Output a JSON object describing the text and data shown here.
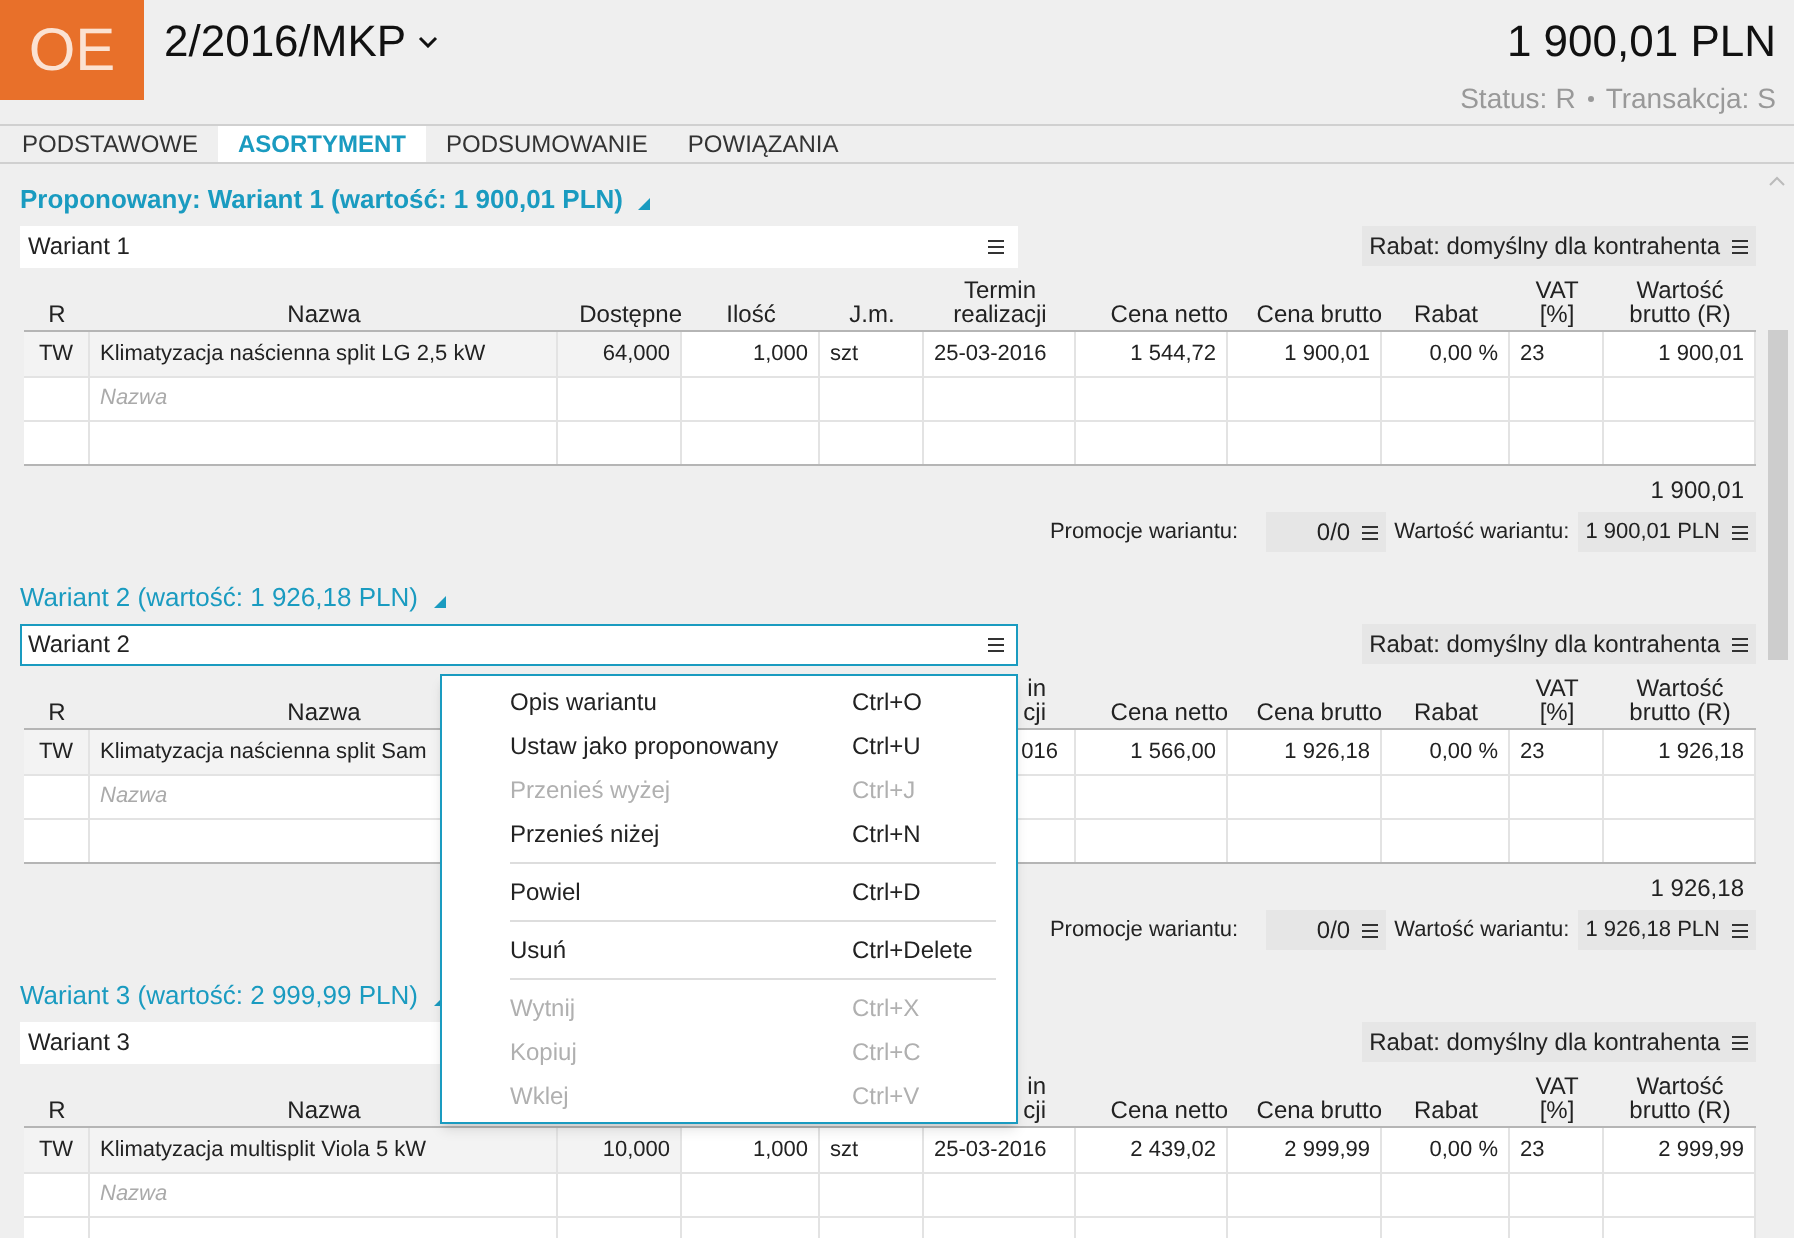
{
  "header": {
    "logo": "OE",
    "document": "2/2016/MKP",
    "amount": "1 900,01 PLN",
    "status_label": "Status:",
    "status": "R",
    "transaction_label": "Transakcja:",
    "transaction": "S"
  },
  "tabs": [
    {
      "label": "PODSTAWOWE",
      "selected": false
    },
    {
      "label": "ASORTYMENT",
      "selected": true
    },
    {
      "label": "PODSUMOWANIE",
      "selected": false
    },
    {
      "label": "POWIĄZANIA",
      "selected": false
    }
  ],
  "variants": [
    {
      "title": "Proponowany: Wariant 1 (wartość: 1 900,01 PLN)",
      "proposed": true,
      "name_field": "Wariant 1",
      "focused": false,
      "field_icon": true,
      "discount": "Rabat: domyślny dla kontrahenta",
      "columns": [
        "R",
        "Nazwa",
        "Dostępne",
        "Ilość",
        "J.m.",
        "Termin\nrealizacji",
        "Cena netto",
        "Cena brutto",
        "Rabat",
        "VAT\n[%]",
        "Wartość\nbrutto (R)"
      ],
      "rows": [
        [
          "TW",
          "Klimatyzacja naścienna split LG 2,5 kW",
          "64,000",
          "1,000",
          "szt",
          "25-03-2016",
          "1 544,72",
          "1 900,01",
          "0,00 %",
          "23",
          "1 900,01"
        ]
      ],
      "placeholder": "Nazwa",
      "total": "1 900,01",
      "promotions_label": "Promocje wariantu:",
      "promotions": "0/0",
      "value_label": "Wartość wariantu:",
      "value": "1 900,01 PLN"
    },
    {
      "title": "Wariant 2 (wartość: 1 926,18 PLN)",
      "proposed": false,
      "name_field": "Wariant 2",
      "focused": true,
      "field_icon": true,
      "discount": "Rabat: domyślny dla kontrahenta",
      "columns": [
        "R",
        "Nazwa",
        null,
        null,
        null,
        {
          "text": "in\ncji",
          "clipped": true
        },
        "Cena netto",
        "Cena brutto",
        "Rabat",
        "VAT\n[%]",
        "Wartość\nbrutto (R)"
      ],
      "rows": [
        [
          "TW",
          "Klimatyzacja naścienna split Sam",
          null,
          null,
          null,
          {
            "text": "016",
            "clipped": true
          },
          "1 566,00",
          "1 926,18",
          "0,00 %",
          "23",
          "1 926,18"
        ]
      ],
      "placeholder": "Nazwa",
      "total": "1 926,18",
      "promotions_label": "Promocje wariantu:",
      "promotions": "0/0",
      "value_label": "Wartość wariantu:",
      "value": "1 926,18 PLN"
    },
    {
      "title": "Wariant 3 (wartość: 2 999,99 PLN)",
      "proposed": false,
      "name_field": "Wariant 3",
      "focused": false,
      "field_icon": false,
      "discount": "Rabat: domyślny dla kontrahenta",
      "columns": [
        "R",
        "Nazwa",
        null,
        null,
        null,
        {
          "text": "in\ncji",
          "clipped": true
        },
        "Cena netto",
        "Cena brutto",
        "Rabat",
        "VAT\n[%]",
        "Wartość\nbrutto (R)"
      ],
      "rows": [
        [
          "TW",
          "Klimatyzacja multisplit Viola 5 kW",
          "10,000",
          "1,000",
          "szt",
          "25-03-2016",
          "2 439,02",
          "2 999,99",
          "0,00 %",
          "23",
          "2 999,99"
        ]
      ],
      "placeholder": "Nazwa"
    }
  ],
  "context_menu": [
    {
      "kind": "item",
      "label": "Opis wariantu",
      "shortcut": "Ctrl+O",
      "disabled": false
    },
    {
      "kind": "item",
      "label": "Ustaw jako proponowany",
      "shortcut": "Ctrl+U",
      "disabled": false
    },
    {
      "kind": "item",
      "label": "Przenieś wyżej",
      "shortcut": "Ctrl+J",
      "disabled": true
    },
    {
      "kind": "item",
      "label": "Przenieś niżej",
      "shortcut": "Ctrl+N",
      "disabled": false
    },
    {
      "kind": "separator"
    },
    {
      "kind": "item",
      "label": "Powiel",
      "shortcut": "Ctrl+D",
      "disabled": false
    },
    {
      "kind": "separator"
    },
    {
      "kind": "item",
      "label": "Usuń",
      "shortcut": "Ctrl+Delete",
      "disabled": false
    },
    {
      "kind": "separator"
    },
    {
      "kind": "item",
      "label": "Wytnij",
      "shortcut": "Ctrl+X",
      "disabled": true
    },
    {
      "kind": "item",
      "label": "Kopiuj",
      "shortcut": "Ctrl+C",
      "disabled": true
    },
    {
      "kind": "item",
      "label": "Wklej",
      "shortcut": "Ctrl+V",
      "disabled": true
    }
  ]
}
